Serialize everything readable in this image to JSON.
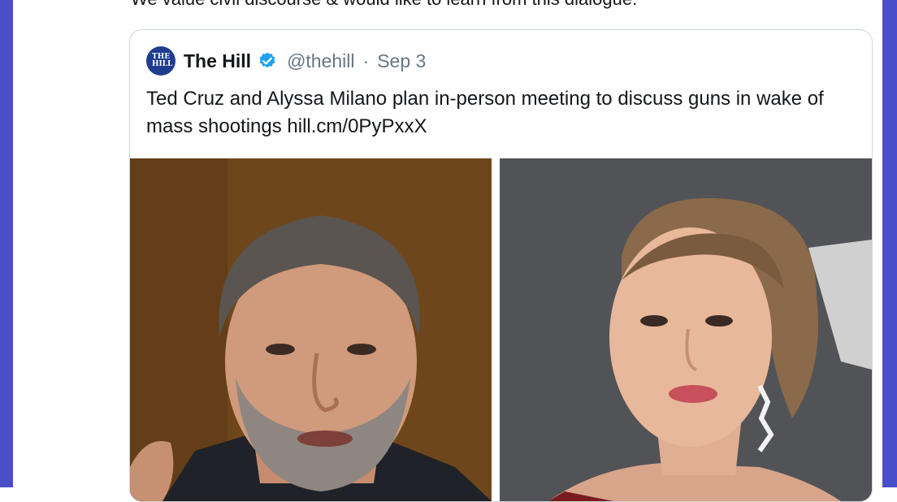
{
  "tweet": {
    "text": "We value civil discourse & would like to learn from this dialogue."
  },
  "quoted_tweet": {
    "avatar_text": "THE HILL",
    "name": "The Hill",
    "verified_icon": "verified-badge-icon",
    "handle": "@thehill",
    "separator": "·",
    "date": "Sep 3",
    "text": "Ted Cruz and Alyssa Milano plan in-person meeting to discuss guns in wake of mass shootings hill.cm/0PyPxxX",
    "images": [
      "photo-left",
      "photo-right"
    ]
  },
  "colors": {
    "frame": "#4a4fc9",
    "verified": "#1da1f2",
    "secondary_text": "#657786",
    "border": "#cdd6dd"
  }
}
